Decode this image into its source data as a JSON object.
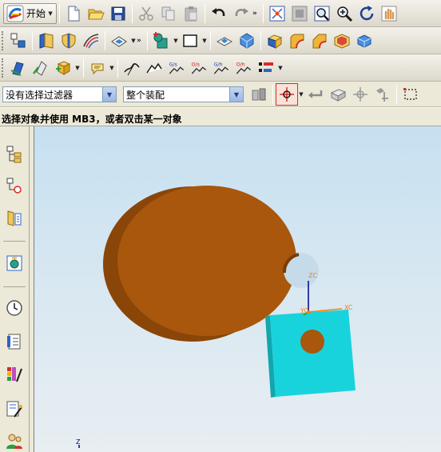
{
  "toolbar": {
    "start_label": "开始",
    "chevron_label": "»"
  },
  "selection_bar": {
    "filter_value": "没有选择过滤器",
    "scope_value": "整个装配"
  },
  "status": {
    "prompt": "选择对象并使用 MB3，或者双击某一对象"
  },
  "toolbar_text_icons": {
    "gs": "G/s",
    "os": "O/s",
    "gh": "G/h",
    "oh": "O/h"
  },
  "viewport": {
    "wcs_z": "ZC",
    "wcs_y": "YC",
    "wcs_x": "XC",
    "abs_z": "Z"
  },
  "colors": {
    "disc": "#a8570c",
    "disc_side": "#8a4508",
    "block": "#19d3dc",
    "block_side": "#11b5bd",
    "wcs_z_axis": "#00008b",
    "wcs_x_axis": "#ff8000"
  }
}
